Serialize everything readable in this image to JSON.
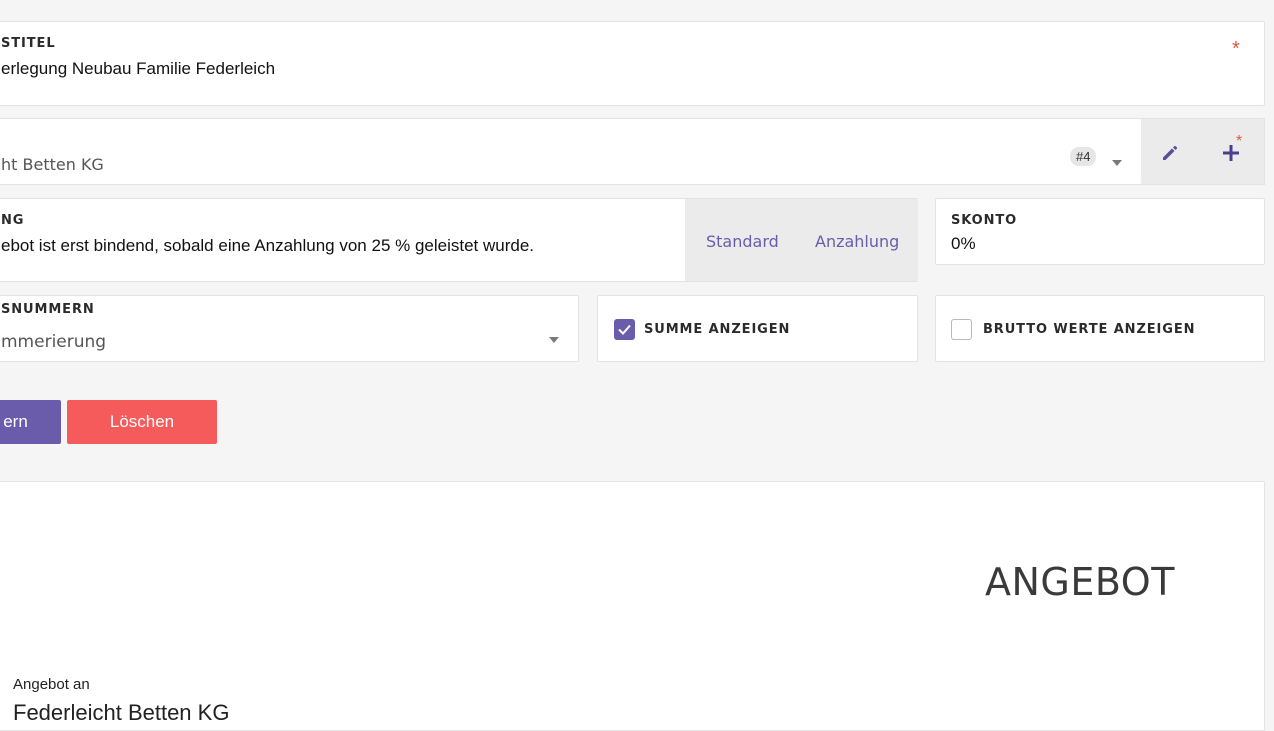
{
  "title_field": {
    "label": "STITEL",
    "value": "erlegung Neubau Familie Federleich",
    "required_mark": "*"
  },
  "customer_field": {
    "value": "ht Betten KG",
    "badge": "#4",
    "edit_icon": "pencil-icon",
    "add_icon": "plus-icon",
    "add_required_mark": "*"
  },
  "condition_field": {
    "label": "NG",
    "value": "ebot ist erst bindend, sobald eine Anzahlung von 25 % geleistet wurde.",
    "options": [
      "Standard",
      "Anzahlung"
    ]
  },
  "skonto_field": {
    "label": "SKONTO",
    "value": "0%"
  },
  "numbering_field": {
    "label": "SNUMMERN",
    "value": "mmerierung"
  },
  "show_sum": {
    "label": "SUMME ANZEIGEN",
    "checked": true
  },
  "gross_values": {
    "label": "BRUTTO WERTE ANZEIGEN",
    "checked": false
  },
  "buttons": {
    "save_label": "ern",
    "delete_label": "Löschen"
  },
  "preview": {
    "heading": "ANGEBOT",
    "recipient_label": "Angebot an",
    "recipient_name": "Federleicht Betten KG"
  },
  "colors": {
    "accent": "#6a5cab",
    "delete": "#f55b5b",
    "required": "#e8553f"
  }
}
